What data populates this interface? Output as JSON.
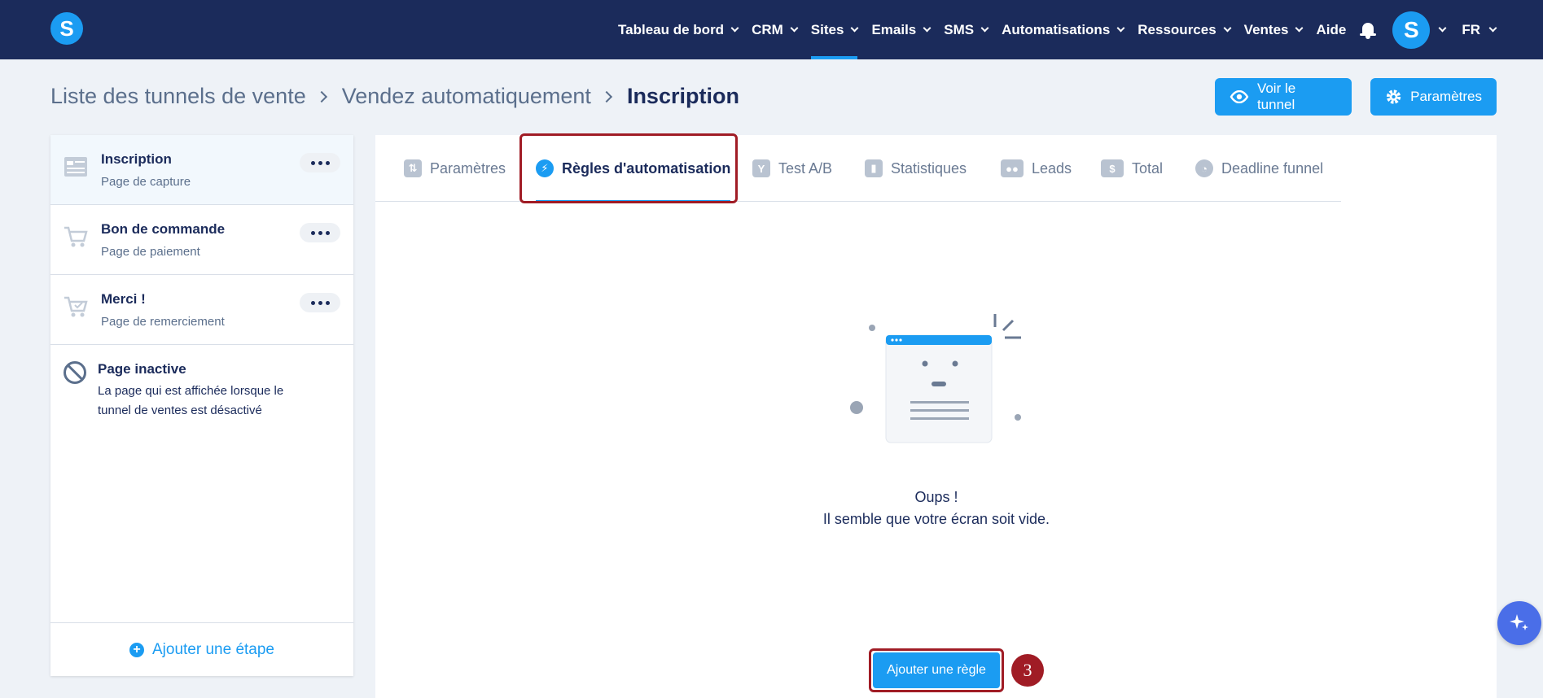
{
  "app": {
    "logo_letter": "S"
  },
  "nav": {
    "items": [
      {
        "label": "Tableau de bord",
        "has_dropdown": true
      },
      {
        "label": "CRM",
        "has_dropdown": true
      },
      {
        "label": "Sites",
        "has_dropdown": true,
        "active": true
      },
      {
        "label": "Emails",
        "has_dropdown": true
      },
      {
        "label": "SMS",
        "has_dropdown": true
      },
      {
        "label": "Automatisations",
        "has_dropdown": true
      },
      {
        "label": "Ressources",
        "has_dropdown": true
      },
      {
        "label": "Ventes",
        "has_dropdown": true
      },
      {
        "label": "Aide",
        "has_dropdown": false
      }
    ],
    "avatar_letter": "S",
    "language": "FR"
  },
  "breadcrumb": {
    "items": [
      "Liste des tunnels de vente",
      "Vendez automatiquement",
      "Inscription"
    ]
  },
  "actions": {
    "view_label": "Voir le tunnel",
    "params_label": "Paramètres"
  },
  "sidebar": {
    "steps": [
      {
        "title": "Inscription",
        "subtitle": "Page de capture",
        "active": true
      },
      {
        "title": "Bon de commande",
        "subtitle": "Page de paiement"
      },
      {
        "title": "Merci !",
        "subtitle": "Page de remerciement"
      }
    ],
    "inactive": {
      "title": "Page inactive",
      "description": "La page qui est affichée lorsque le tunnel de ventes est désactivé"
    },
    "add_step_label": "Ajouter une étape"
  },
  "tabs": [
    {
      "label": "Paramètres",
      "icon": "sliders-icon"
    },
    {
      "label": "Règles d'automatisation",
      "icon": "bolt-icon",
      "active": true
    },
    {
      "label": "Test A/B",
      "icon": "split-icon"
    },
    {
      "label": "Statistiques",
      "icon": "bar-chart-icon"
    },
    {
      "label": "Leads",
      "icon": "users-icon"
    },
    {
      "label": "Total",
      "icon": "dollar-icon"
    },
    {
      "label": "Deadline funnel",
      "icon": "clock-icon"
    }
  ],
  "empty_state": {
    "line1": "Oups !",
    "line2": "Il semble que votre écran soit vide."
  },
  "add_rule_label": "Ajouter une règle",
  "annotation_badge": "3",
  "colors": {
    "nav_bg": "#1b2b5b",
    "accent": "#1b9cf2",
    "highlight": "#a01c25"
  }
}
